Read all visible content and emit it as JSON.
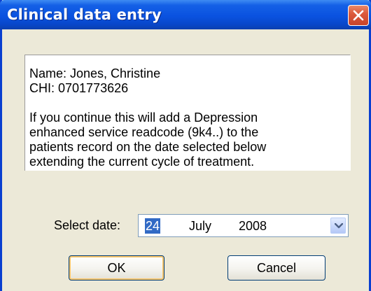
{
  "window": {
    "title": "Clinical data entry"
  },
  "message": {
    "name_line": "Name: Jones, Christine",
    "chi_line": "CHI: 0701773626",
    "body_lines": [
      "If you continue this will add a Depression",
      "enhanced service readcode (9k4..) to the",
      "patients record on the date selected below",
      "extending the current cycle of treatment."
    ]
  },
  "date": {
    "label": "Select date:",
    "day": "24",
    "month": "July",
    "year": "2008"
  },
  "buttons": {
    "ok_label": "OK",
    "cancel_label": "Cancel"
  },
  "icons": {
    "close": "close-icon",
    "dropdown": "chevron-down-icon"
  },
  "colors": {
    "titlebar": "#0a52e0",
    "close_button": "#dc5a3c",
    "selection": "#316ac5",
    "dialog_bg": "#ece9d8"
  }
}
